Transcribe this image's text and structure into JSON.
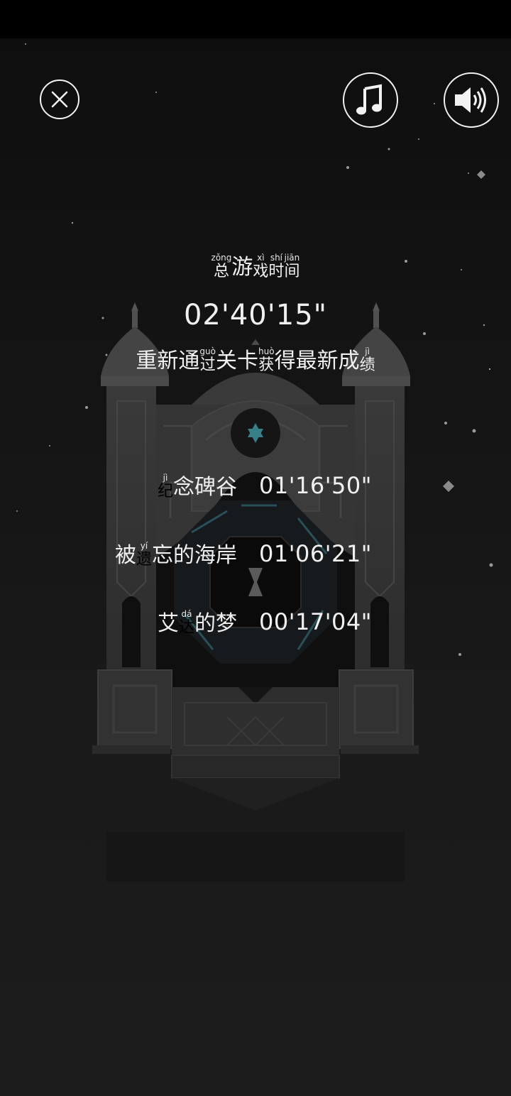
{
  "controls": {
    "close": "close-icon",
    "music": "music-note-icon",
    "sound": "speaker-volume-icon"
  },
  "colors": {
    "background": "#141414",
    "text": "#f0f0f0",
    "accent_teal": "#3a8c95"
  },
  "total": {
    "title": [
      {
        "py": "zǒng",
        "hz": "总"
      },
      {
        "py": "",
        "hz": "游"
      },
      {
        "py": "xì",
        "hz": "戏"
      },
      {
        "py": "shí",
        "hz": "时"
      },
      {
        "py": "jiān",
        "hz": "间"
      }
    ],
    "time": "02'40'15\""
  },
  "hint": [
    {
      "py": "",
      "hz": "重"
    },
    {
      "py": "",
      "hz": "新"
    },
    {
      "py": "",
      "hz": "通"
    },
    {
      "py": "guò",
      "hz": "过"
    },
    {
      "py": "",
      "hz": "关"
    },
    {
      "py": "",
      "hz": "卡"
    },
    {
      "py": "huò",
      "hz": "获"
    },
    {
      "py": "",
      "hz": "得"
    },
    {
      "py": "",
      "hz": "最"
    },
    {
      "py": "",
      "hz": "新"
    },
    {
      "py": "",
      "hz": "成"
    },
    {
      "py": "jì",
      "hz": "绩"
    }
  ],
  "levels": [
    {
      "name": [
        {
          "py": "jì",
          "hz": "纪"
        },
        {
          "py": "",
          "hz": "念"
        },
        {
          "py": "",
          "hz": "碑"
        },
        {
          "py": "",
          "hz": "谷"
        }
      ],
      "time": "01'16'50\""
    },
    {
      "name": [
        {
          "py": "",
          "hz": "被"
        },
        {
          "py": "yí",
          "hz": "遗"
        },
        {
          "py": "",
          "hz": "忘"
        },
        {
          "py": "",
          "hz": "的"
        },
        {
          "py": "",
          "hz": "海"
        },
        {
          "py": "",
          "hz": "岸"
        }
      ],
      "time": "01'06'21\""
    },
    {
      "name": [
        {
          "py": "",
          "hz": "艾"
        },
        {
          "py": "dá",
          "hz": "达"
        },
        {
          "py": "",
          "hz": "的"
        },
        {
          "py": "",
          "hz": "梦"
        }
      ],
      "time": "00'17'04\""
    }
  ]
}
